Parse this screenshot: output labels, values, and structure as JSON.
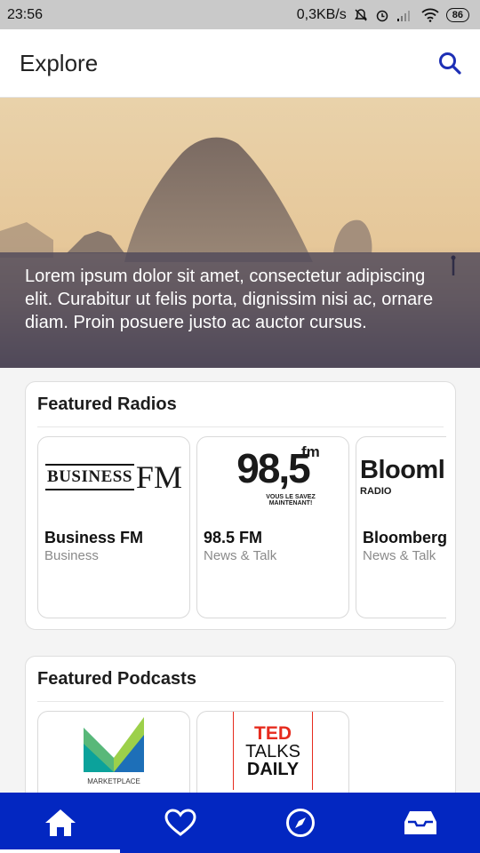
{
  "status_bar": {
    "time": "23:56",
    "speed": "0,3KB/s",
    "battery": "86"
  },
  "app_bar": {
    "title": "Explore",
    "search_icon": "search-icon"
  },
  "hero": {
    "caption": "Lorem ipsum dolor sit amet, consectetur adipiscing elit. Curabitur ut felis porta, dignissim nisi ac, ornare diam. Proin posuere justo ac auctor cursus."
  },
  "featured_radios": {
    "title": "Featured Radios",
    "items": [
      {
        "name": "Business FM",
        "category": "Business",
        "logo": {
          "text_a": "BUSINESS",
          "text_b": "FM"
        }
      },
      {
        "name": "98.5 FM",
        "category": "News & Talk",
        "logo": {
          "main": "98,5",
          "fm": "fm",
          "tag1": "VOUS LE SAVEZ",
          "tag2": "MAINTENANT!"
        }
      },
      {
        "name": "Bloomberg",
        "category": "News & Talk",
        "logo": {
          "text_a": "Blooml",
          "text_b": "RADIO"
        }
      }
    ]
  },
  "featured_podcasts": {
    "title": "Featured Podcasts",
    "items": [
      {
        "logo_text": "MARKETPLACE"
      },
      {
        "logo_lines": [
          "TED",
          "TALKS",
          "DAILY"
        ]
      }
    ]
  },
  "bottom_nav": {
    "items": [
      "home-icon",
      "heart-icon",
      "compass-icon",
      "inbox-icon"
    ],
    "active": "home"
  },
  "colors": {
    "nav_bg": "#0327c1",
    "search_icon": "#1d2fb5",
    "ted_red": "#e62b1e"
  }
}
